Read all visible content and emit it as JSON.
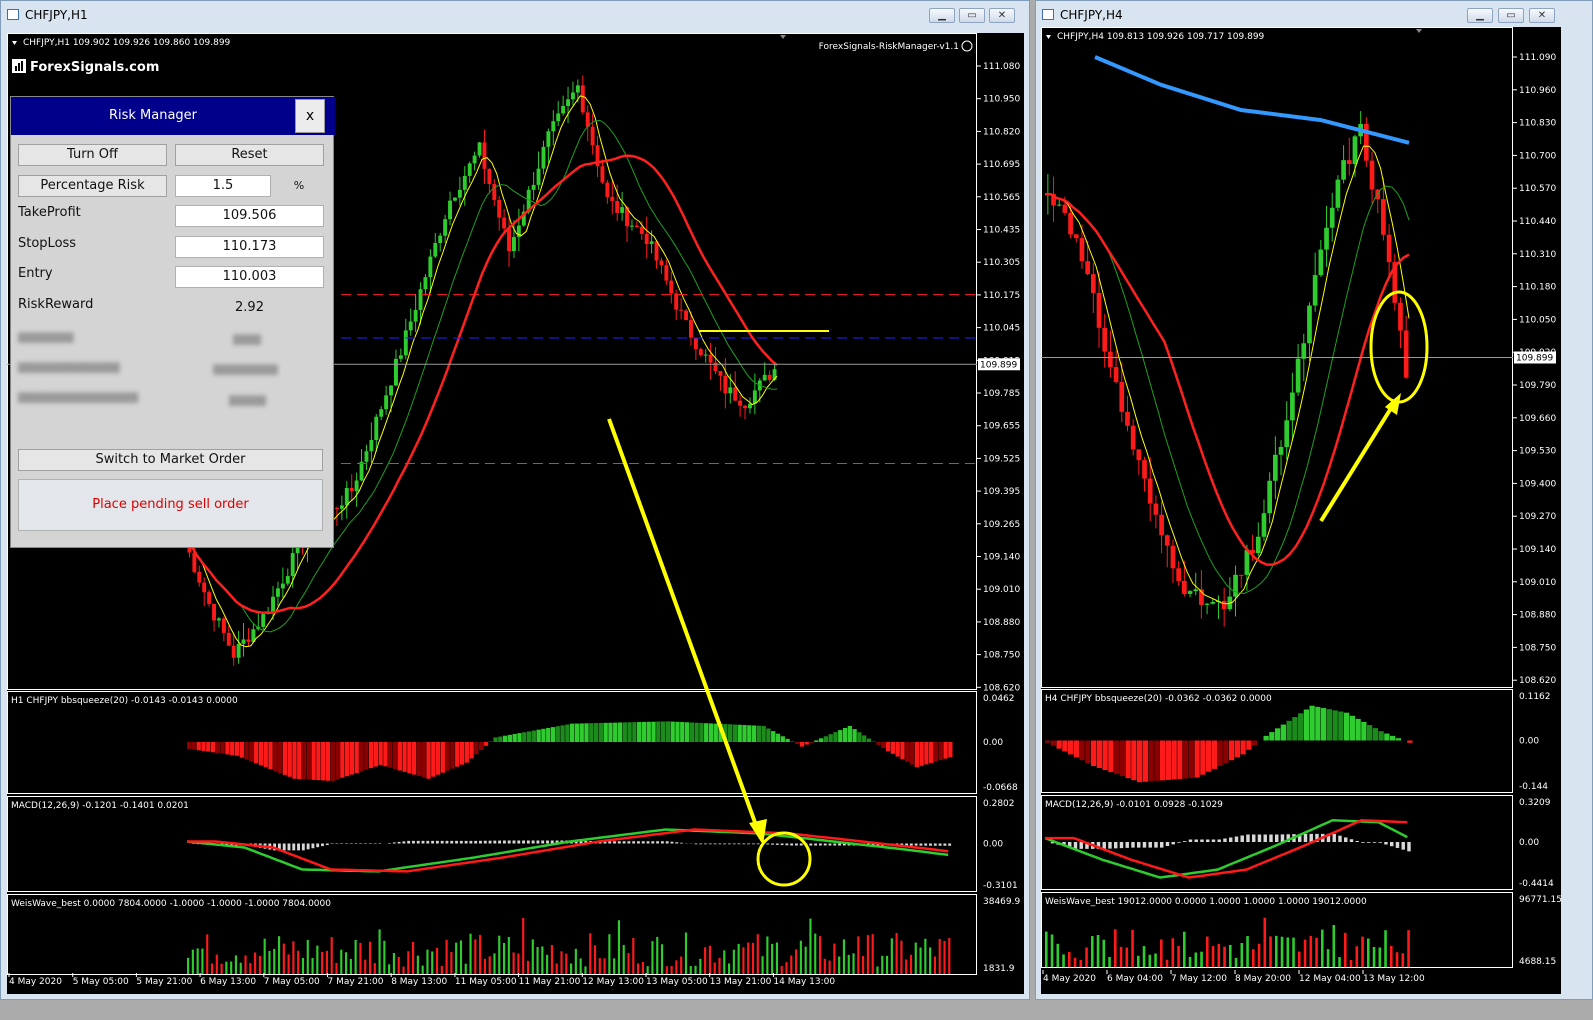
{
  "left_window": {
    "title": "CHFJPY,H1",
    "chart_header": "CHFJPY,H1  109.902 109.926 109.860 109.899",
    "logo": "ForexSignals.com",
    "ea_label": "ForexSignals-RiskManager-v1.1",
    "current_price": "109.899",
    "price_labels": [
      "111.080",
      "110.950",
      "110.820",
      "110.695",
      "110.565",
      "110.435",
      "110.305",
      "110.175",
      "110.045",
      "109.915",
      "109.785",
      "109.655",
      "109.525",
      "109.395",
      "109.265",
      "109.140",
      "109.010",
      "108.880",
      "108.750",
      "108.620"
    ],
    "bbsqueeze_label": "H1 CHFJPY bbsqueeze(20) -0.0143 -0.0143 0.0000",
    "bbsqueeze_scale": [
      "0.0462",
      "0.00",
      "-0.0668"
    ],
    "macd_label": "MACD(12,26,9) -0.1201 -0.1401 0.0201",
    "macd_scale": [
      "0.2802",
      "0.00",
      "-0.3101"
    ],
    "weis_label": "WeisWave_best 0.0000 7804.0000 -1.0000 -1.0000 -1.0000 7804.0000",
    "weis_scale": [
      "38469.9",
      "1831.9"
    ],
    "time_labels": [
      "4 May 2020",
      "5 May 05:00",
      "5 May 21:00",
      "6 May 13:00",
      "7 May 05:00",
      "7 May 21:00",
      "8 May 13:00",
      "11 May 05:00",
      "11 May 21:00",
      "12 May 13:00",
      "13 May 05:00",
      "13 May 21:00",
      "14 May 13:00"
    ]
  },
  "right_window": {
    "title": "CHFJPY,H4",
    "chart_header": "CHFJPY,H4  109.813 109.926 109.717 109.899",
    "current_price": "109.899",
    "price_labels": [
      "111.090",
      "110.960",
      "110.830",
      "110.700",
      "110.570",
      "110.440",
      "110.310",
      "110.180",
      "110.050",
      "109.920",
      "109.790",
      "109.660",
      "109.530",
      "109.400",
      "109.270",
      "109.140",
      "109.010",
      "108.880",
      "108.750",
      "108.620"
    ],
    "bbsqueeze_label": "H4 CHFJPY bbsqueeze(20) -0.0362 -0.0362 0.0000",
    "bbsqueeze_scale": [
      "0.1162",
      "0.00",
      "-0.144"
    ],
    "macd_label": "MACD(12,26,9) -0.0101 0.0928 -0.1029",
    "macd_scale": [
      "0.3209",
      "0.00",
      "-0.4414"
    ],
    "weis_label": "WeisWave_best 19012.0000 0.0000 1.0000 1.0000 1.0000 19012.0000",
    "weis_scale": [
      "96771.15",
      "4688.15"
    ],
    "time_labels": [
      "4 May 2020",
      "6 May 04:00",
      "7 May 12:00",
      "8 May 20:00",
      "12 May 04:00",
      "13 May 12:00"
    ]
  },
  "risk_manager": {
    "title": "Risk Manager",
    "close_label": "x",
    "turn_off_label": "Turn Off",
    "reset_label": "Reset",
    "percentage_risk_label": "Percentage Risk",
    "percentage_value": "1.5",
    "percent_sign": "%",
    "take_profit_label": "TakeProfit",
    "take_profit_value": "109.506",
    "stop_loss_label": "StopLoss",
    "stop_loss_value": "110.173",
    "entry_label": "Entry",
    "entry_value": "110.003",
    "risk_reward_label": "RiskReward",
    "risk_reward_value": "2.92",
    "switch_label": "Switch to Market Order",
    "place_order_label": "Place pending sell order"
  },
  "colors": {
    "bull": "#2ecc2e",
    "bear": "#ff1a1a",
    "ma_fast": "#ffff00",
    "ma_mid": "#1fa01f",
    "ma_slow": "#ff2020",
    "ma_long": "#3399ff",
    "annotation": "#ffff00",
    "dialog_header": "#00008b"
  }
}
